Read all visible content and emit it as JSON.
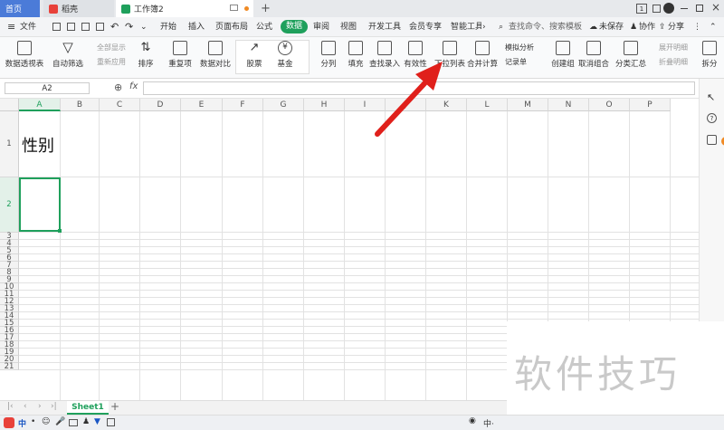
{
  "tabs": [
    {
      "label": "首页"
    },
    {
      "label": "稻壳"
    },
    {
      "label": "工作簿2"
    }
  ],
  "window": {
    "badge": "1"
  },
  "menubar": {
    "file": "文件",
    "items": [
      "开始",
      "插入",
      "页面布局",
      "公式",
      "数据",
      "审阅",
      "视图",
      "开发工具",
      "会员专享",
      "智能工具箱"
    ],
    "active": "数据",
    "search_placeholder": "查找命令、搜索模板",
    "unsaved": "未保存",
    "collab": "协作",
    "share": "分享"
  },
  "ribbon": {
    "pivot": "数据透视表",
    "autofilter": "自动筛选",
    "show_all": "全部显示",
    "reapply": "重新应用",
    "sort": "排序",
    "duplicates": "重复项",
    "compare": "数据对比",
    "stock": "股票",
    "fund": "基金",
    "split": "分列",
    "fill": "填充",
    "lookup": "查找录入",
    "validity": "有效性",
    "dropdown": "下拉列表",
    "consolidate": "合并计算",
    "whatif": "模拟分析",
    "record": "记录单",
    "group": "创建组",
    "ungroup": "取消组合",
    "subtotal": "分类汇总",
    "expand": "展开明细",
    "collapse": "折叠明细",
    "split2": "拆分"
  },
  "formula": {
    "cell_ref": "A2",
    "fx": "fx",
    "value": ""
  },
  "columns": [
    "A",
    "B",
    "C",
    "D",
    "E",
    "F",
    "G",
    "H",
    "I",
    "J",
    "K",
    "L",
    "M",
    "N",
    "O",
    "P"
  ],
  "rows": [
    "1",
    "2",
    "3",
    "4",
    "5",
    "6",
    "7",
    "8",
    "9",
    "10",
    "11",
    "12",
    "13",
    "14",
    "15",
    "16",
    "17",
    "18",
    "19",
    "20",
    "21"
  ],
  "cells": {
    "A1": "性别"
  },
  "sheet_tab": "Sheet1",
  "watermark": "软件技巧",
  "colors": {
    "accent": "#1fa05c",
    "arrow": "#e0201b"
  }
}
